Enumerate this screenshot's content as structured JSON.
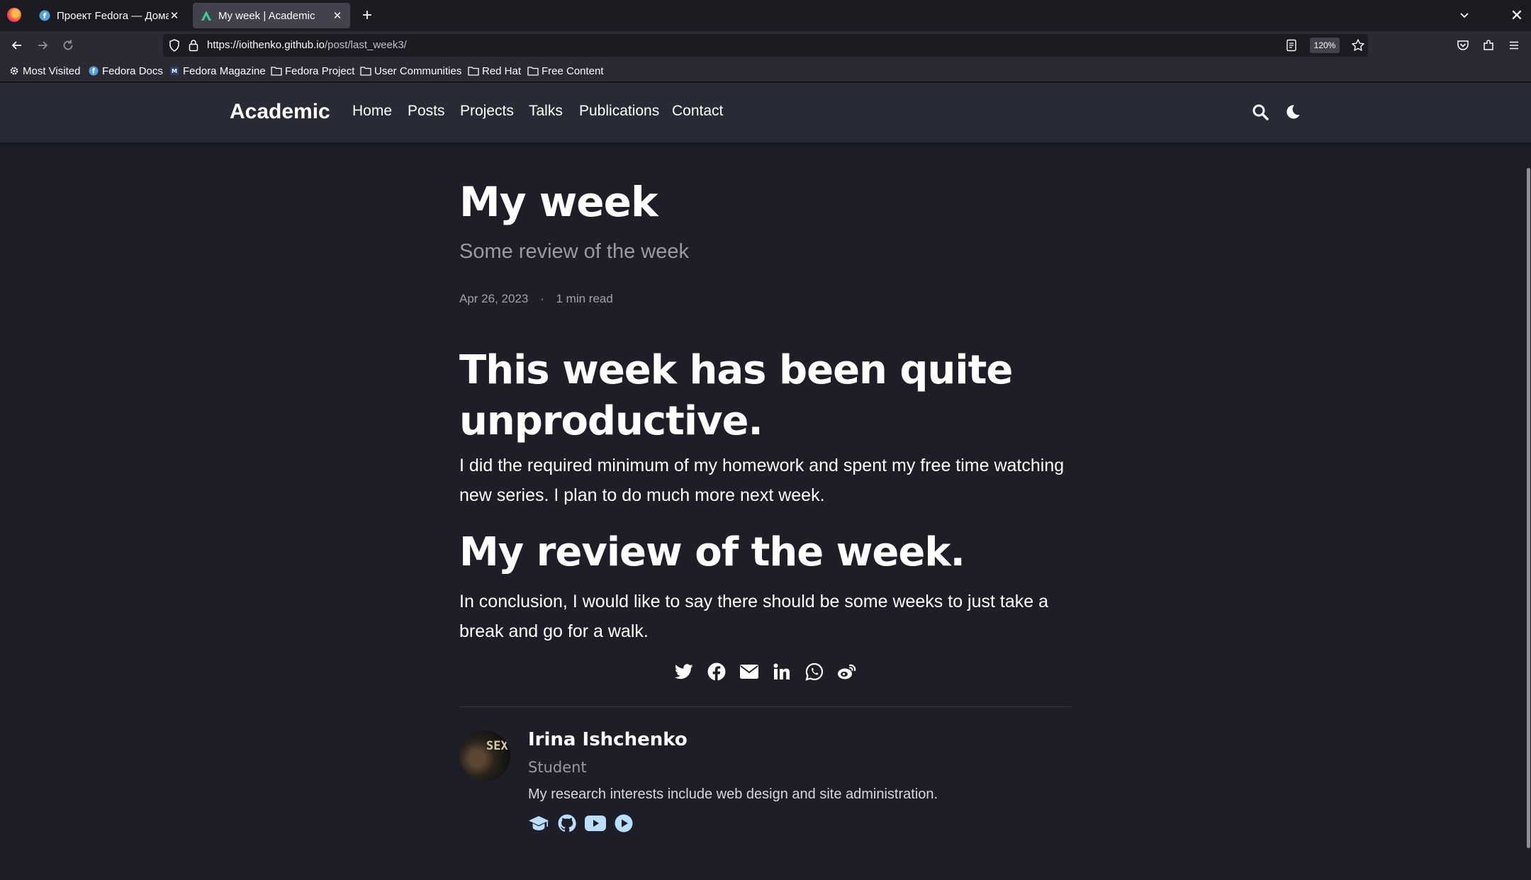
{
  "browser": {
    "tabs": [
      {
        "title": "Проект Fedora — Домаш",
        "active": false
      },
      {
        "title": "My week | Academic",
        "active": true
      }
    ],
    "url": {
      "host": "https://ioithenko.github.io",
      "path": "/post/last_week3/"
    },
    "zoom": "120%",
    "bookmarks": [
      "Most Visited",
      "Fedora Docs",
      "Fedora Magazine",
      "Fedora Project",
      "User Communities",
      "Red Hat",
      "Free Content"
    ]
  },
  "site": {
    "brand": "Academic",
    "menu": [
      "Home",
      "Posts",
      "Projects",
      "Talks",
      "Publications",
      "Contact"
    ]
  },
  "post": {
    "title": "My week",
    "subtitle": "Some review of the week",
    "date": "Apr 26, 2023",
    "meta_separator": "·",
    "reading_time": "1 min read",
    "heading1": "This week has been quite unproductive.",
    "paragraph1": "I did the required minimum of my homework and spent my free time watching new series. I plan to do much more next week.",
    "heading2": "My review of the week.",
    "paragraph2": "In conclusion, I would like to say there should be some weeks to just take a break and go for a walk.",
    "share_icons": [
      "twitter-icon",
      "facebook-icon",
      "email-icon",
      "linkedin-icon",
      "whatsapp-icon",
      "weibo-icon"
    ]
  },
  "author": {
    "name": "Irina Ishchenko",
    "role": "Student",
    "bio": "My research interests include web design and site administration.",
    "link_icons": [
      "graduation-cap-icon",
      "github-icon",
      "youtube-icon",
      "play-circle-icon"
    ]
  },
  "colors": {
    "page_background": "#1d1e28",
    "navbar_background": "#282a36",
    "icon_accent": "#bbdefb",
    "browser_chrome": "#2b2a33"
  }
}
